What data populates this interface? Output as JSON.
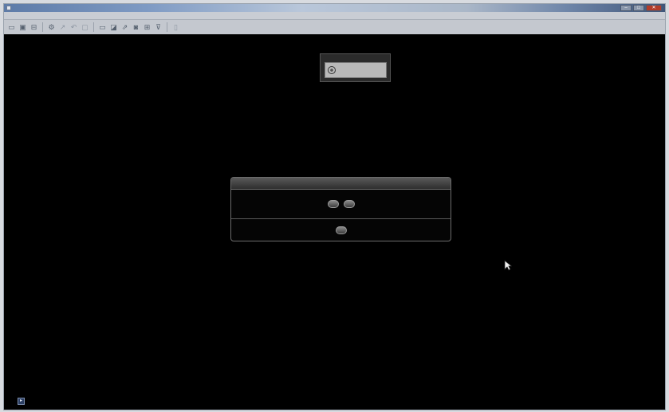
{
  "window": {
    "title": "",
    "menu": [
      "",
      "",
      "",
      "",
      "",
      ""
    ],
    "controls": {
      "minimize": "–",
      "maximize": "□",
      "close": "✕"
    }
  },
  "toolbar": {
    "icons": [
      "open-icon",
      "save-icon",
      "print-icon",
      "settings-icon",
      "arrow-icon",
      "undo-icon",
      "refresh-icon",
      "window-icon",
      "cube-icon",
      "link-icon",
      "camera-icon",
      "grid-icon",
      "view-icon",
      "help-icon"
    ]
  },
  "logo": {
    "text": ""
  },
  "dialog": {
    "title": "",
    "options": [
      "",
      ""
    ],
    "cancel_label": ""
  },
  "colors": {
    "canvas": "#000000",
    "dialog_border": "#6c6c6c",
    "titlebar_accent": "#5d7ba8"
  }
}
